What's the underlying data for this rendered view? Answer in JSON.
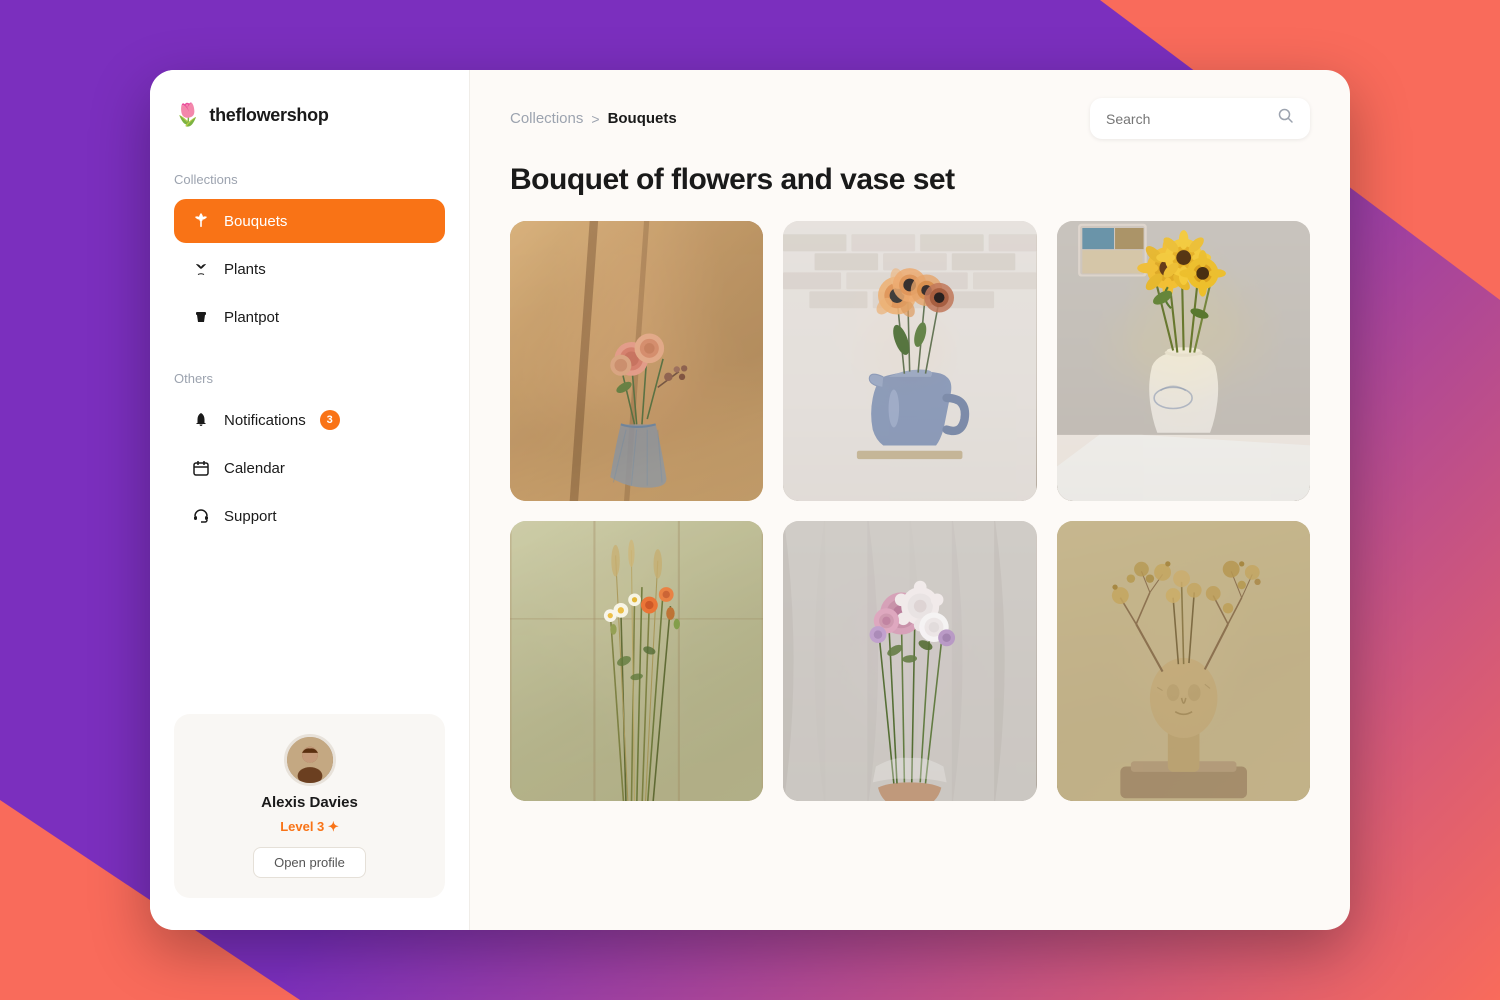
{
  "app": {
    "name": "theflowershop",
    "logo_icon": "🌷"
  },
  "sidebar": {
    "collections_label": "Collections",
    "others_label": "Others",
    "nav_items": [
      {
        "id": "bouquets",
        "label": "Bouquets",
        "icon": "flower",
        "active": true
      },
      {
        "id": "plants",
        "label": "Plants",
        "icon": "plant",
        "active": false
      },
      {
        "id": "plantpot",
        "label": "Plantpot",
        "icon": "pot",
        "active": false
      }
    ],
    "other_items": [
      {
        "id": "notifications",
        "label": "Notifications",
        "icon": "bell",
        "badge": "3"
      },
      {
        "id": "calendar",
        "label": "Calendar",
        "icon": "calendar",
        "badge": null
      },
      {
        "id": "support",
        "label": "Support",
        "icon": "headset",
        "badge": null
      }
    ],
    "profile": {
      "name": "Alexis Davies",
      "level": "Level 3 ✦",
      "btn_label": "Open profile"
    }
  },
  "header": {
    "breadcrumb_collections": "Collections",
    "breadcrumb_sep": ">",
    "breadcrumb_current": "Bouquets",
    "search_placeholder": "Search"
  },
  "main": {
    "page_title": "Bouquet of flowers and vase set",
    "gallery_items": [
      {
        "id": 1,
        "alt": "Roses in glass vase"
      },
      {
        "id": 2,
        "alt": "Flowers in ceramic pitcher"
      },
      {
        "id": 3,
        "alt": "Sunflowers in white vase"
      },
      {
        "id": 4,
        "alt": "Wildflowers bouquet"
      },
      {
        "id": 5,
        "alt": "Pink and white bouquet"
      },
      {
        "id": 6,
        "alt": "Dried flowers sculpture"
      }
    ]
  }
}
